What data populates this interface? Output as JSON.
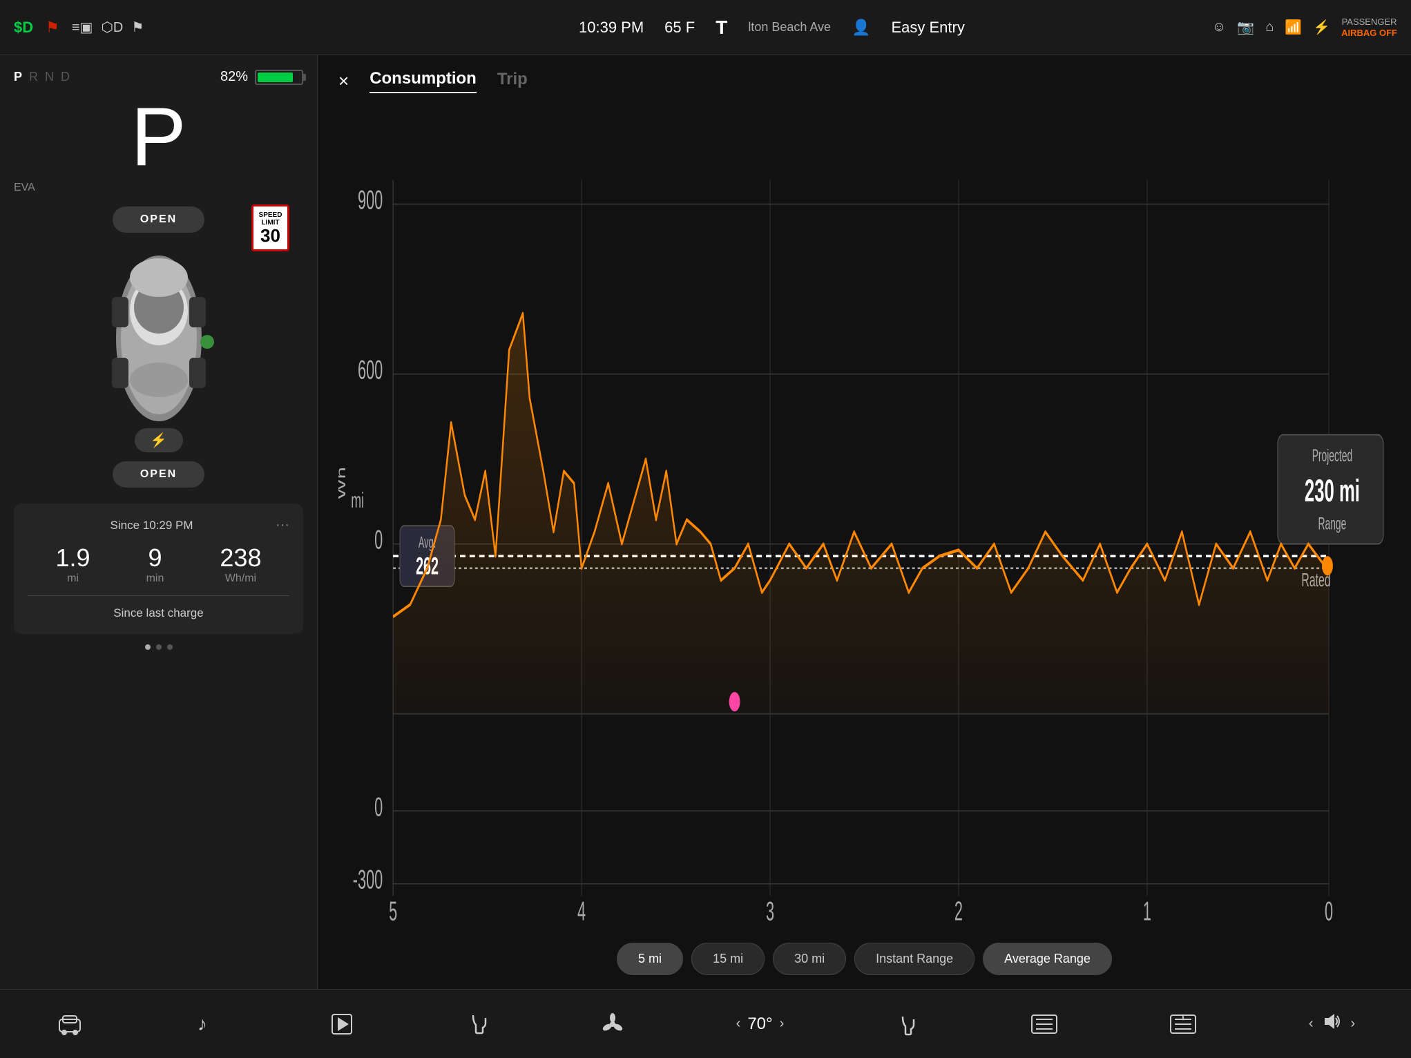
{
  "statusBar": {
    "leftIcon1": "$D",
    "leftIcon2": "🚨",
    "time": "10:39 PM",
    "temp": "65 F",
    "teslaBadge": "T",
    "navText": "lton Beach Ave",
    "easyEntry": "Easy Entry",
    "passengerAirbag": "PASSENGER",
    "airbagStatus": "AIRBAG OFF"
  },
  "leftPanel": {
    "gear": "P",
    "gearLetters": [
      "P",
      "R",
      "N",
      "D"
    ],
    "activeGear": "P",
    "batteryPct": "82%",
    "evaLabel": "EVA",
    "openButtonTop": "OPEN",
    "openButtonBottom": "OPEN",
    "speedLimit": "30",
    "speedLimitLabel": "SPEED LIMIT",
    "statsTitle": "Since 10:29 PM",
    "statsMiValue": "1.9",
    "statsMiUnit": "mi",
    "statsMinValue": "9",
    "statsMinUnit": "min",
    "statsWhValue": "238",
    "statsWhUnit": "Wh/mi",
    "sinceCharge": "Since last charge",
    "dotsCount": 3
  },
  "chart": {
    "title": "Consumption",
    "tabInactive": "Trip",
    "closeLabel": "×",
    "yAxisLabels": [
      "900",
      "600",
      "0",
      "-300"
    ],
    "xAxisLabels": [
      "5",
      "4",
      "3",
      "2",
      "1",
      "0"
    ],
    "avgLabel": "Avg.",
    "avgValue": "262",
    "projectedLabel": "Projected",
    "projectedValue": "230 mi",
    "projectedUnit": "Range",
    "ratedLabel": "Rated",
    "whMiLabel": "Wh\nmi",
    "buttons": {
      "btn5mi": "5 mi",
      "btn15mi": "15 mi",
      "btn30mi": "30 mi",
      "btnInstant": "Instant Range",
      "btnAverage": "Average Range"
    }
  },
  "bottomBar": {
    "carIcon": "🚗",
    "musicIcon": "♪",
    "uploadIcon": "⬆",
    "seatIcon": "🪑",
    "fanIcon": "❄",
    "tempLeft": "<",
    "tempValue": "70°",
    "tempRight": ">",
    "seatHeatIcon": "💺",
    "rearDefrostIcon": "⬛",
    "rearHeatIcon": "⬛",
    "volLeft": "<",
    "volIcon": "🔊",
    "volRight": ">"
  },
  "colors": {
    "background": "#0d0d0d",
    "panelBg": "#1c1c1c",
    "chartBg": "#111111",
    "accent": "#ff8800",
    "battery": "#00cc44",
    "statusBar": "#1a1a1a",
    "airbagOff": "#ff6600",
    "activeGear": "#ffffff",
    "chartLine": "#ff8800",
    "avgLine": "#ffffff",
    "ratedLine": "#cccccc"
  }
}
